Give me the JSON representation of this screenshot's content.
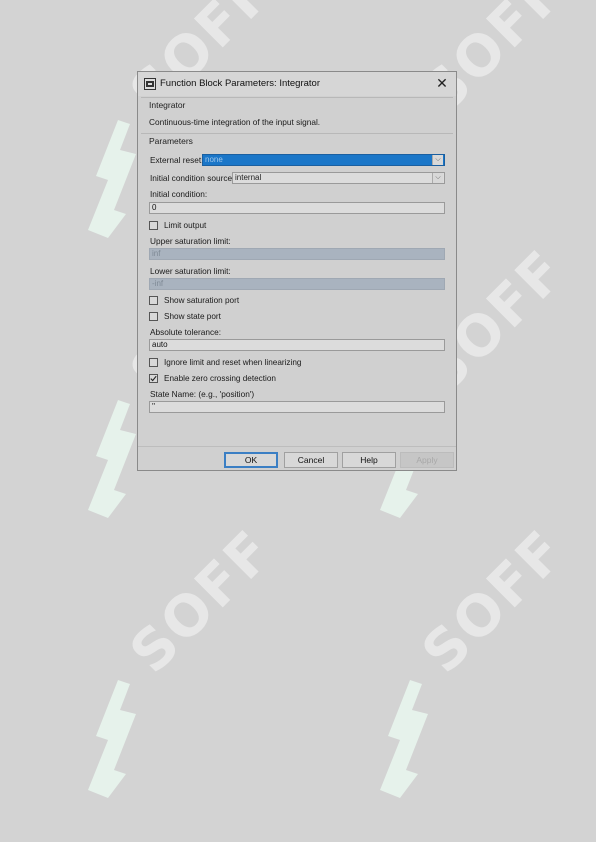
{
  "dialog": {
    "title": "Function Block Parameters: Integrator",
    "block_name": "Integrator",
    "description": "Continuous-time integration of the input signal.",
    "parameters_label": "Parameters",
    "external_reset": {
      "label": "External reset:",
      "value": "none"
    },
    "ic_source": {
      "label": "Initial condition source:",
      "value": "internal"
    },
    "initial_condition": {
      "label": "Initial condition:",
      "value": "0"
    },
    "limit_output": {
      "label": "Limit output",
      "checked": false
    },
    "upper_sat": {
      "label": "Upper saturation limit:",
      "value": "inf"
    },
    "lower_sat": {
      "label": "Lower saturation limit:",
      "value": "-inf"
    },
    "show_sat_port": {
      "label": "Show saturation port",
      "checked": false
    },
    "show_state_port": {
      "label": "Show state port",
      "checked": false
    },
    "abs_tol": {
      "label": "Absolute tolerance:",
      "value": "auto"
    },
    "ignore_limit": {
      "label": "Ignore limit and reset when linearizing",
      "checked": false
    },
    "zero_crossing": {
      "label": "Enable zero crossing detection",
      "checked": true
    },
    "state_name": {
      "label": "State Name: (e.g., 'position')",
      "value": "''"
    },
    "buttons": {
      "ok": "OK",
      "cancel": "Cancel",
      "help": "Help",
      "apply": "Apply"
    },
    "close_glyph": "✕"
  },
  "watermark": {
    "text": "SOFF",
    "color": "#e6f5ec"
  }
}
